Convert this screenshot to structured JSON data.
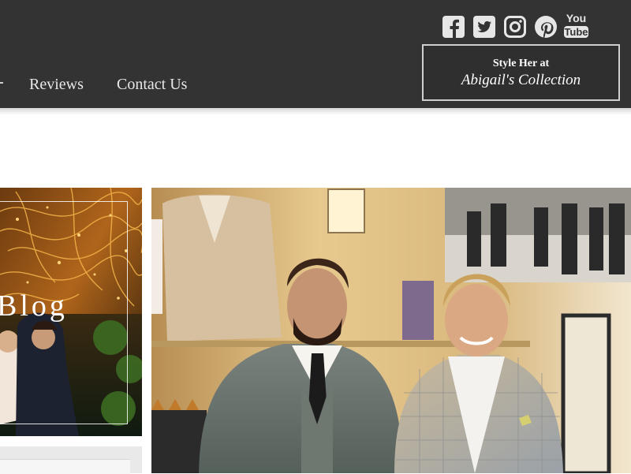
{
  "nav": {
    "items": [
      {
        "label": "Reviews"
      },
      {
        "label": "Contact Us"
      }
    ]
  },
  "social": [
    {
      "icon": "facebook-icon"
    },
    {
      "icon": "twitter-icon"
    },
    {
      "icon": "instagram-icon"
    },
    {
      "icon": "pinterest-icon"
    },
    {
      "icon": "youtube-icon",
      "label_top": "You",
      "label_bottom": "Tube"
    }
  ],
  "cta": {
    "line1": "Style Her at",
    "line2": "Abigail's Collection"
  },
  "blog": {
    "label": "Blog"
  },
  "colors": {
    "header_bg": "#333333",
    "text_light": "#e8e8e8",
    "border_light": "#cfcfcf"
  }
}
